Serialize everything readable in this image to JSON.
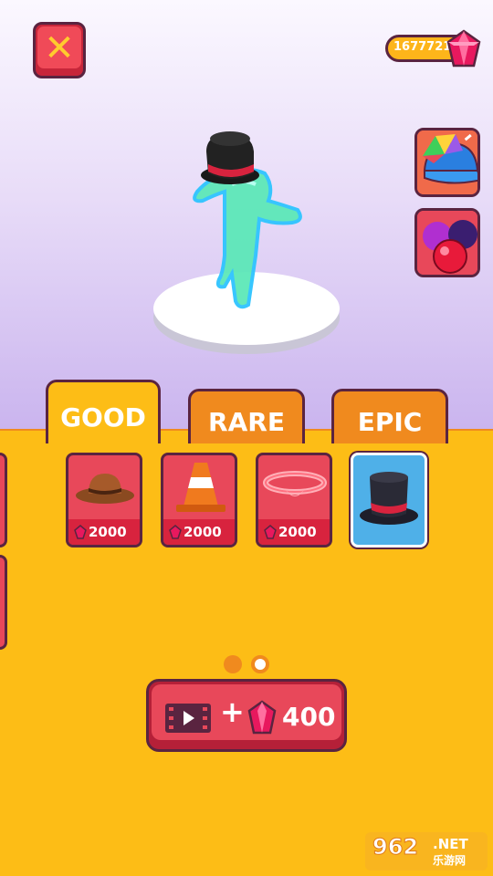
{
  "header": {
    "close_symbol": "✕",
    "gems": "16777215"
  },
  "tabs": [
    {
      "label": "GOOD",
      "active": true
    },
    {
      "label": "RARE",
      "active": false
    },
    {
      "label": "EPIC",
      "active": false
    }
  ],
  "items": [
    {
      "name": "cowboy-hat",
      "price": "2000"
    },
    {
      "name": "traffic-cone",
      "price": "2000"
    },
    {
      "name": "halo",
      "price": "2000"
    },
    {
      "name": "top-hat",
      "selected": true
    }
  ],
  "pagination": {
    "total": 2,
    "current": 1
  },
  "reward": {
    "plus": "+",
    "amount": "400"
  },
  "watermark": {
    "logo": "962",
    "suffix": ".NET",
    "cn": "乐游网"
  },
  "colors": {
    "ground": "#fdbd16",
    "tab_inactive": "#f08a1e",
    "button_red": "#e8485a",
    "outline": "#5a2440",
    "gem": "#e8185e"
  }
}
